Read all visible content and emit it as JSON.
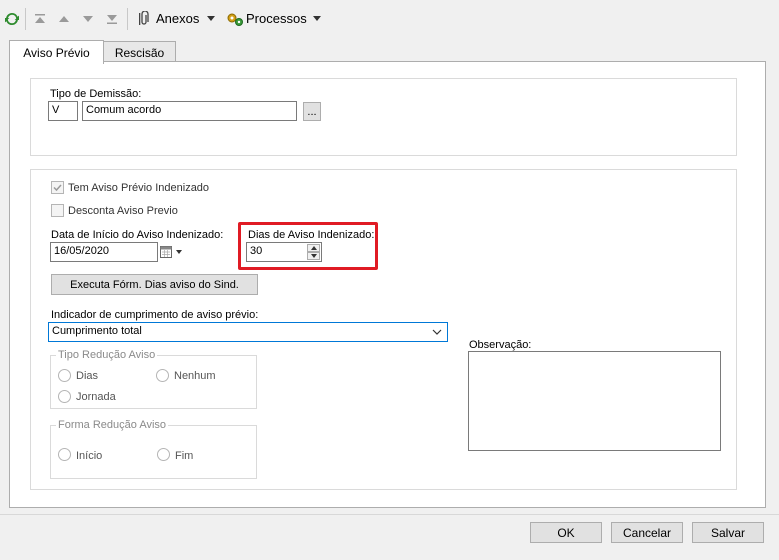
{
  "toolbar": {
    "anexos_label": "Anexos",
    "processos_label": "Processos"
  },
  "tabs": [
    {
      "label": "Aviso Prévio",
      "active": true
    },
    {
      "label": "Rescisão",
      "active": false
    }
  ],
  "tipo_demissao": {
    "label": "Tipo de Demissão:",
    "code": "V",
    "description": "Comum acordo",
    "lookup_label": "..."
  },
  "checkboxes": {
    "tem_aviso": {
      "label": "Tem Aviso Prévio Indenizado",
      "checked": true,
      "enabled": false
    },
    "desconta_aviso": {
      "label": "Desconta Aviso Previo",
      "checked": false,
      "enabled": false
    }
  },
  "data_inicio": {
    "label": "Data de Início do Aviso Indenizado:",
    "value": "16/05/2020"
  },
  "dias_aviso": {
    "label": "Dias de Aviso Indenizado:",
    "value": "30"
  },
  "executa_button": "Executa Fórm. Dias aviso do Sind.",
  "indicador": {
    "label": "Indicador de cumprimento de aviso prévio:",
    "value": "Cumprimento total"
  },
  "tipo_reducao": {
    "legend": "Tipo Redução Aviso",
    "options": [
      "Dias",
      "Nenhum",
      "Jornada"
    ]
  },
  "forma_reducao": {
    "legend": "Forma Redução Aviso",
    "options": [
      "Início",
      "Fim"
    ]
  },
  "observacao": {
    "label": "Observação:",
    "value": ""
  },
  "footer": {
    "ok": "OK",
    "cancelar": "Cancelar",
    "salvar": "Salvar"
  },
  "colors": {
    "highlight": "#e01b24",
    "dropdown_border": "#0078d7"
  }
}
